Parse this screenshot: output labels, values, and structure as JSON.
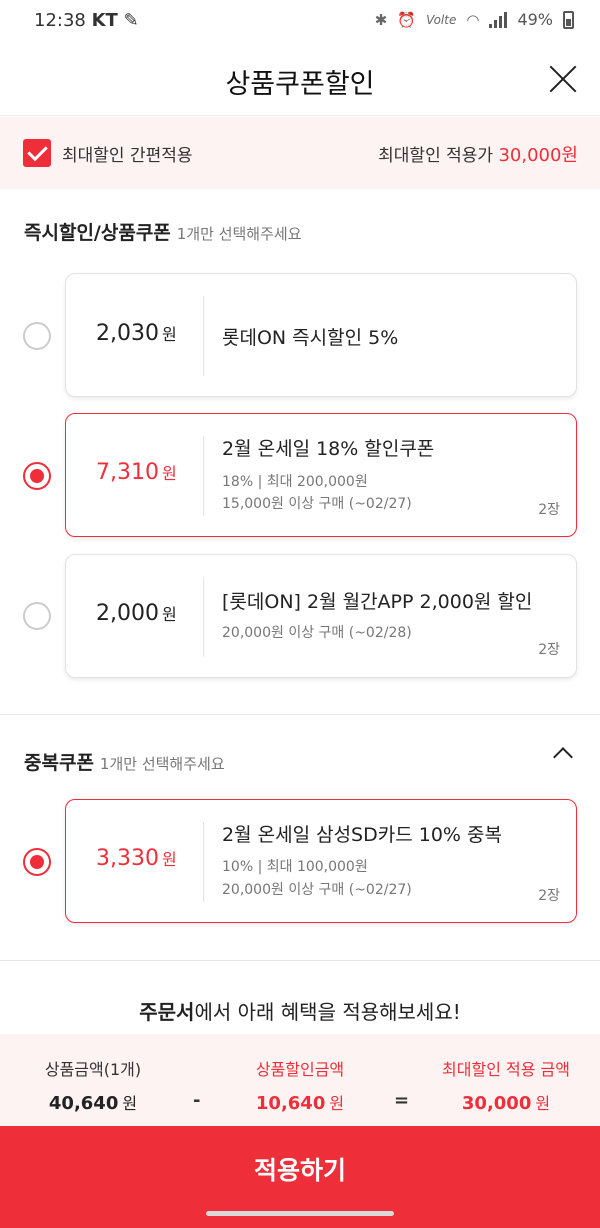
{
  "status_bar": {
    "time": "12:38",
    "carrier": "KT",
    "battery": "49%",
    "network": "Volte"
  },
  "header": {
    "title": "상품쿠폰할인"
  },
  "max_discount": {
    "checkbox_label": "최대할인 간편적용",
    "checked": true,
    "right_label": "최대할인 적용가",
    "right_value": "30,000원"
  },
  "instant_section": {
    "title": "즉시할인/상품쿠폰",
    "hint": "1개만 선택해주세요",
    "coupons": [
      {
        "amount": "2,030",
        "unit": "원",
        "name": "롯데ON 즉시할인 5%",
        "selected": false
      },
      {
        "amount": "7,310",
        "unit": "원",
        "name": "2월 온세일 18% 할인쿠폰",
        "line1": "18% | 최대 200,000원",
        "line2": "15,000원 이상 구매 (~02/27)",
        "qty": "2장",
        "selected": true
      },
      {
        "amount": "2,000",
        "unit": "원",
        "name": "[롯데ON] 2월 월간APP 2,000원 할인",
        "line1": "20,000원 이상 구매 (~02/28)",
        "qty": "2장",
        "selected": false
      }
    ]
  },
  "stack_section": {
    "title": "중복쿠폰",
    "hint": "1개만 선택해주세요",
    "coupons": [
      {
        "amount": "3,330",
        "unit": "원",
        "name": "2월 온세일 삼성SD카드 10% 중복",
        "line1": "10% | 최대 100,000원",
        "line2": "20,000원 이상 구매 (~02/27)",
        "qty": "2장",
        "selected": true
      }
    ]
  },
  "promo": {
    "bold": "주문서",
    "rest": "에서 아래 혜택을 적용해보세요!"
  },
  "summary": {
    "product": {
      "label": "상품금액(1개)",
      "value": "40,640",
      "unit": "원"
    },
    "minus": "-",
    "discount": {
      "label": "상품할인금액",
      "value": "10,640",
      "unit": "원"
    },
    "equals": "=",
    "final": {
      "label": "최대할인 적용 금액",
      "value": "30,000",
      "unit": "원"
    }
  },
  "apply_button": {
    "label": "적용하기"
  },
  "colors": {
    "accent": "#ee2f3a",
    "tint": "#fdf3f3"
  }
}
